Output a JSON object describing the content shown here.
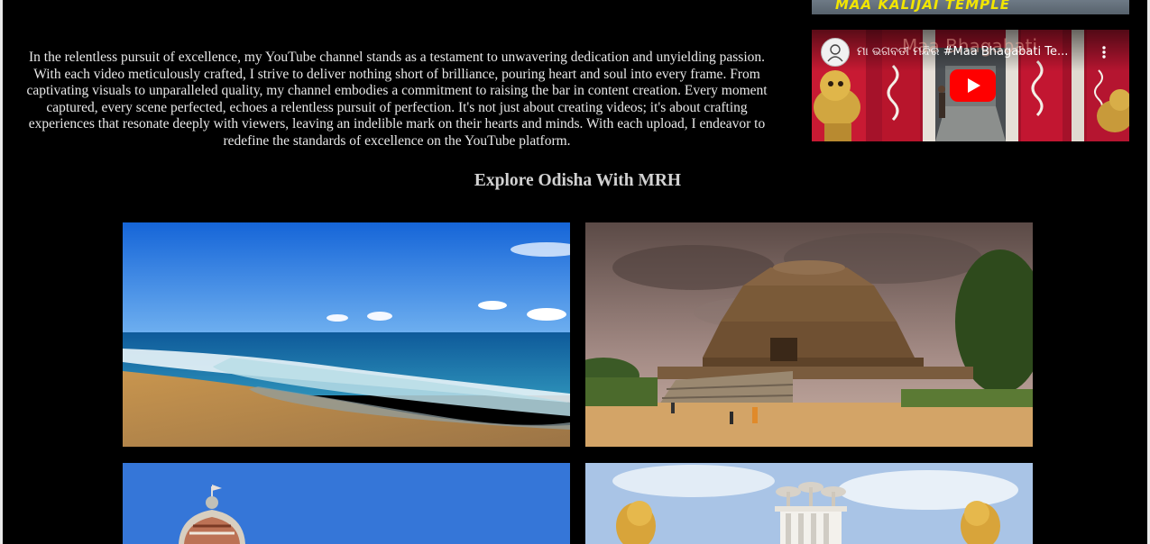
{
  "intro": {
    "text": "In the relentless pursuit of excellence, my YouTube channel stands as a testament to unwavering dedication and unyielding passion. With each video meticulously crafted, I strive to deliver nothing short of brilliance, pouring heart and soul into every frame. From captivating visuals to unparalleled quality, my channel embodies a commitment to raising the bar in content creation. Every moment captured, every scene perfected, echoes a relentless pursuit of perfection. It's not just about creating videos; it's about crafting experiences that resonate deeply with viewers, leaving an indelible mark on their hearts and minds. With each upload, I endeavor to redefine the standards of excellence on the YouTube platform."
  },
  "videos": [
    {
      "caption": "MAA KALIJAI TEMPLE"
    },
    {
      "title": "ମା ଭଗବତୀ ମନ୍ଦିର #Maa Bhagabati Te...",
      "watermark": "Maa Bhagabati",
      "menu_icon": "more-vert-icon",
      "play_icon": "youtube-play-icon",
      "play_color": "#ff0000"
    }
  ],
  "section": {
    "heading": "Explore Odisha With MRH"
  },
  "gallery": {
    "photos": [
      {
        "subject": "beach"
      },
      {
        "subject": "sun-temple"
      },
      {
        "subject": "jagannath-temple"
      },
      {
        "subject": "shanti-stupa"
      }
    ]
  },
  "colors": {
    "background": "#000000",
    "text": "#e8e8e8",
    "heading": "#d2d2d2"
  }
}
